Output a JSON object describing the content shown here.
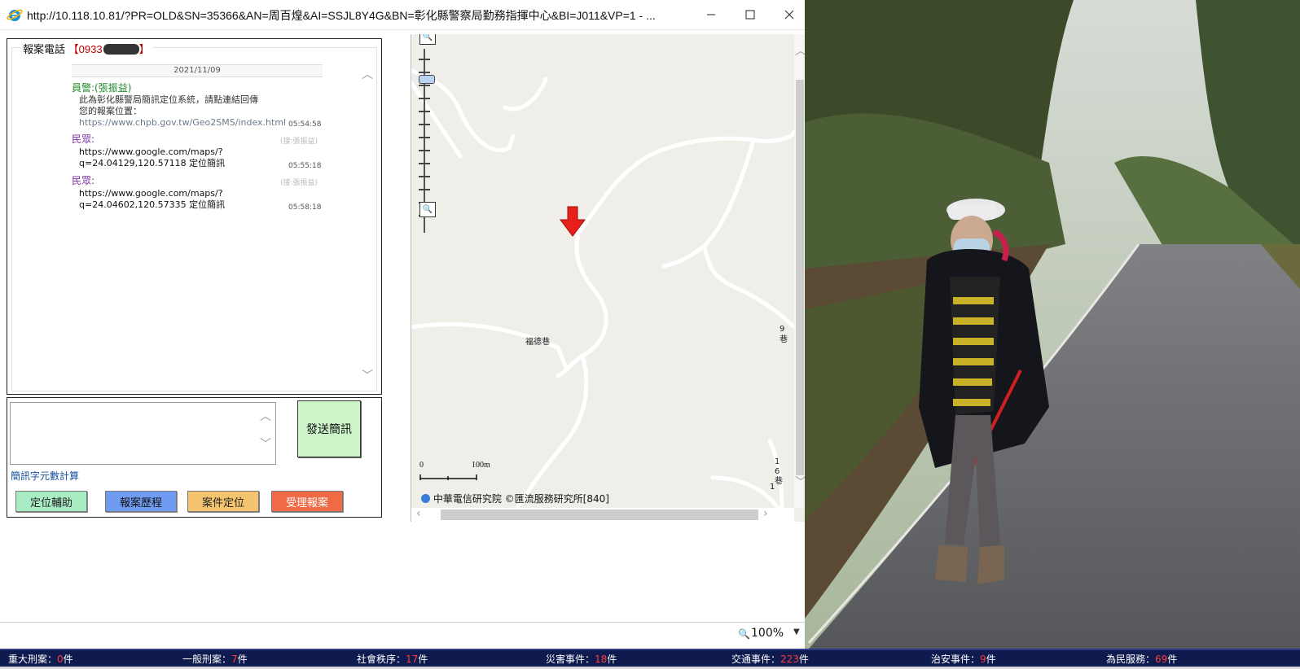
{
  "window": {
    "title": "http://10.118.10.81/?PR=OLD&SN=35366&AN=周百煌&AI=SSJL8Y4G&BN=彰化縣警察局勤務指揮中心&BI=J011&VP=1 - ..."
  },
  "chat": {
    "phone_label": "報案電話",
    "phone_number": "0933",
    "date": "2021/11/09",
    "messages": [
      {
        "sender": "員警:(張振益)",
        "lines": [
          "此為彰化縣警局簡訊定位系統，請點連結回傳",
          "您的報案位置：",
          "https://www.chpb.gov.tw/Geo2SMS/index.html"
        ],
        "time": "05:54:58"
      },
      {
        "sender": "民眾:",
        "meta": "(接:張振益)",
        "lines": [
          "https://www.google.com/maps/?",
          "q=24.04129,120.57118 定位簡訊"
        ],
        "time": "05:55:18"
      },
      {
        "sender": "民眾:",
        "meta": "(接:張振益)",
        "lines": [
          "https://www.google.com/maps/?",
          "q=24.04602,120.57335 定位簡訊"
        ],
        "time": "05:58:18"
      }
    ]
  },
  "compose": {
    "send_label": "發送簡訊",
    "char_count_label": "簡訊字元數計算",
    "buttons": [
      {
        "label": "定位輔助",
        "color": "#a8ecc4"
      },
      {
        "label": "報案歷程",
        "color": "#6f9bf0"
      },
      {
        "label": "案件定位",
        "color": "#f5c46e"
      },
      {
        "label": "受理報案",
        "color": "#f06a45"
      }
    ]
  },
  "map": {
    "road_label": "福德巷",
    "scale_zero": "0",
    "scale_end": "100m",
    "copyright": "中華電信研究院 ©匯流服務研究所[840]",
    "edge_label_1": "9巷",
    "edge_label_2": "16巷",
    "edge_label_3": "1",
    "marker_color": "#e8201a"
  },
  "status": {
    "zoom": "100%"
  },
  "stats": [
    {
      "label": "重大刑案：",
      "count": "0",
      "unit": "件"
    },
    {
      "label": "一般刑案：",
      "count": "7",
      "unit": "件"
    },
    {
      "label": "社會秩序：",
      "count": "17",
      "unit": "件"
    },
    {
      "label": "災害事件：",
      "count": "18",
      "unit": "件"
    },
    {
      "label": "交通事件：",
      "count": "223",
      "unit": "件"
    },
    {
      "label": "治安事件：",
      "count": "9",
      "unit": "件"
    },
    {
      "label": "為民服務：",
      "count": "69",
      "unit": "件"
    }
  ]
}
